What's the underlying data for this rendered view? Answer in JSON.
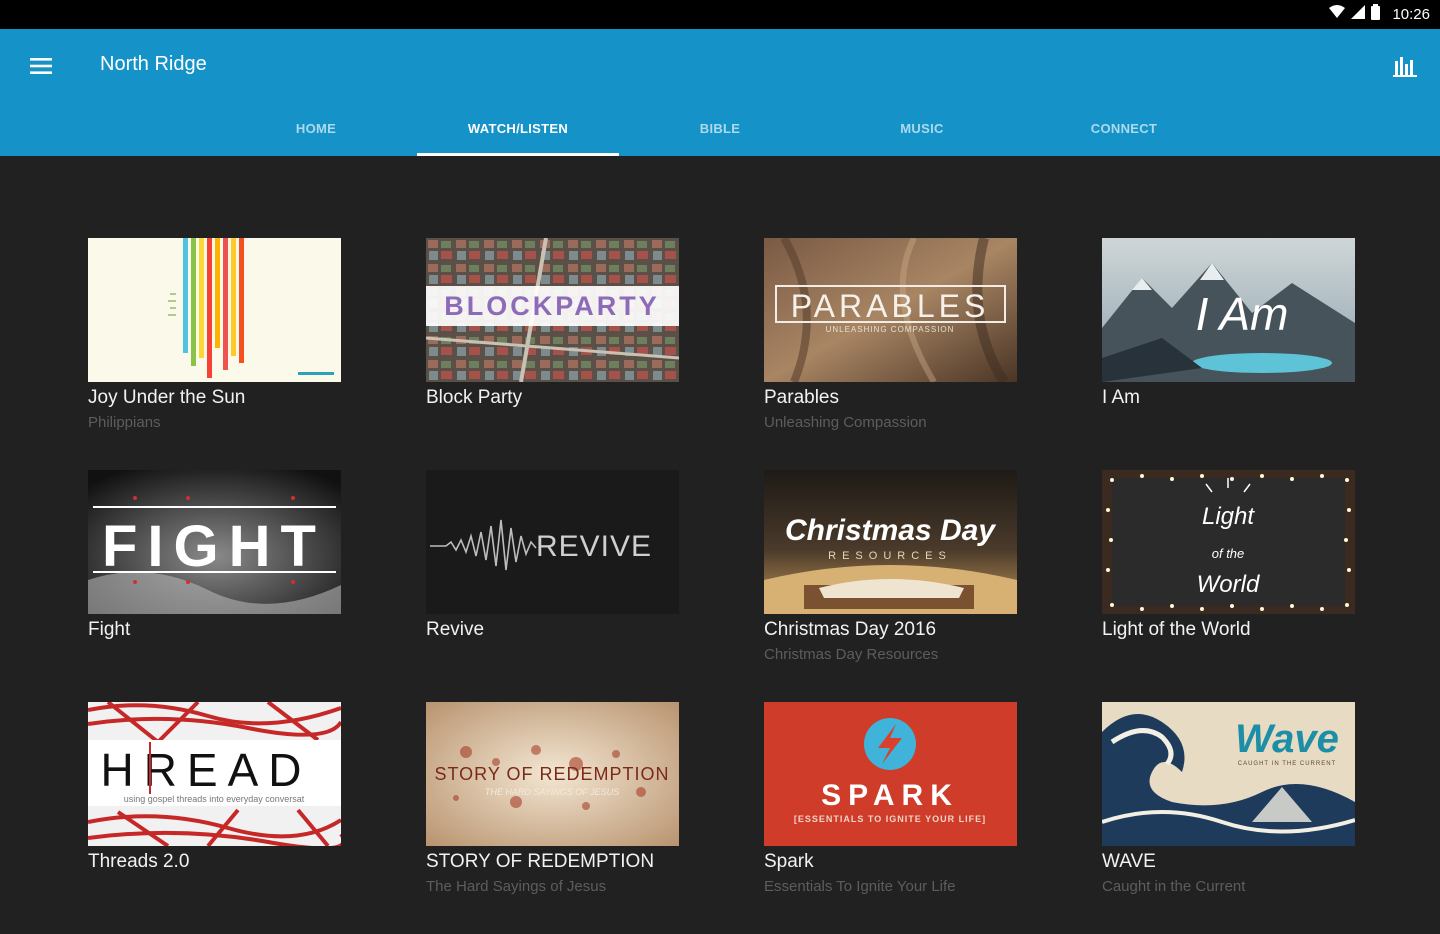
{
  "status": {
    "time": "10:26"
  },
  "header": {
    "title": "North Ridge",
    "tabs": [
      {
        "label": "HOME",
        "active": false
      },
      {
        "label": "WATCH/LISTEN",
        "active": true
      },
      {
        "label": "BIBLE",
        "active": false
      },
      {
        "label": "MUSIC",
        "active": false
      },
      {
        "label": "CONNECT",
        "active": false
      }
    ]
  },
  "series": [
    {
      "title": "Joy Under the Sun",
      "subtitle": "Philippians"
    },
    {
      "title": "Block Party",
      "subtitle": "",
      "thumb_text": "BLOCKPARTY"
    },
    {
      "title": "Parables",
      "subtitle": "Unleashing Compassion",
      "thumb_text": "PARABLES",
      "thumb_sub": "UNLEASHING COMPASSION"
    },
    {
      "title": "I Am",
      "subtitle": "",
      "thumb_text": "I Am"
    },
    {
      "title": "Fight",
      "subtitle": "",
      "thumb_text": "FIGHT"
    },
    {
      "title": "Revive",
      "subtitle": "",
      "thumb_text": "REVIVE"
    },
    {
      "title": "Christmas Day 2016",
      "subtitle": "Christmas Day Resources",
      "thumb_text": "Christmas Day",
      "thumb_sub": "RESOURCES"
    },
    {
      "title": "Light of the World",
      "subtitle": "",
      "thumb_text": "Light",
      "thumb_sub": "of the",
      "thumb_sub2": "World"
    },
    {
      "title": "Threads 2.0",
      "subtitle": "",
      "thumb_text": "HREAD",
      "thumb_sub": "using gospel threads into everyday conversat"
    },
    {
      "title": "STORY OF REDEMPTION",
      "subtitle": "The Hard Sayings of Jesus",
      "thumb_text": "STORY OF REDEMPTION",
      "thumb_sub": "THE HARD SAYINGS OF JESUS"
    },
    {
      "title": "Spark",
      "subtitle": "Essentials To Ignite Your Life",
      "thumb_text": "SPARK",
      "thumb_sub": "[ESSENTIALS TO IGNITE YOUR LIFE]"
    },
    {
      "title": "WAVE",
      "subtitle": "Caught in the Current",
      "thumb_text": "Wave",
      "thumb_sub": "CAUGHT IN THE CURRENT"
    }
  ],
  "colors": {
    "app_bar": "#1592c8",
    "background": "#212121",
    "status_bar": "#000000"
  }
}
